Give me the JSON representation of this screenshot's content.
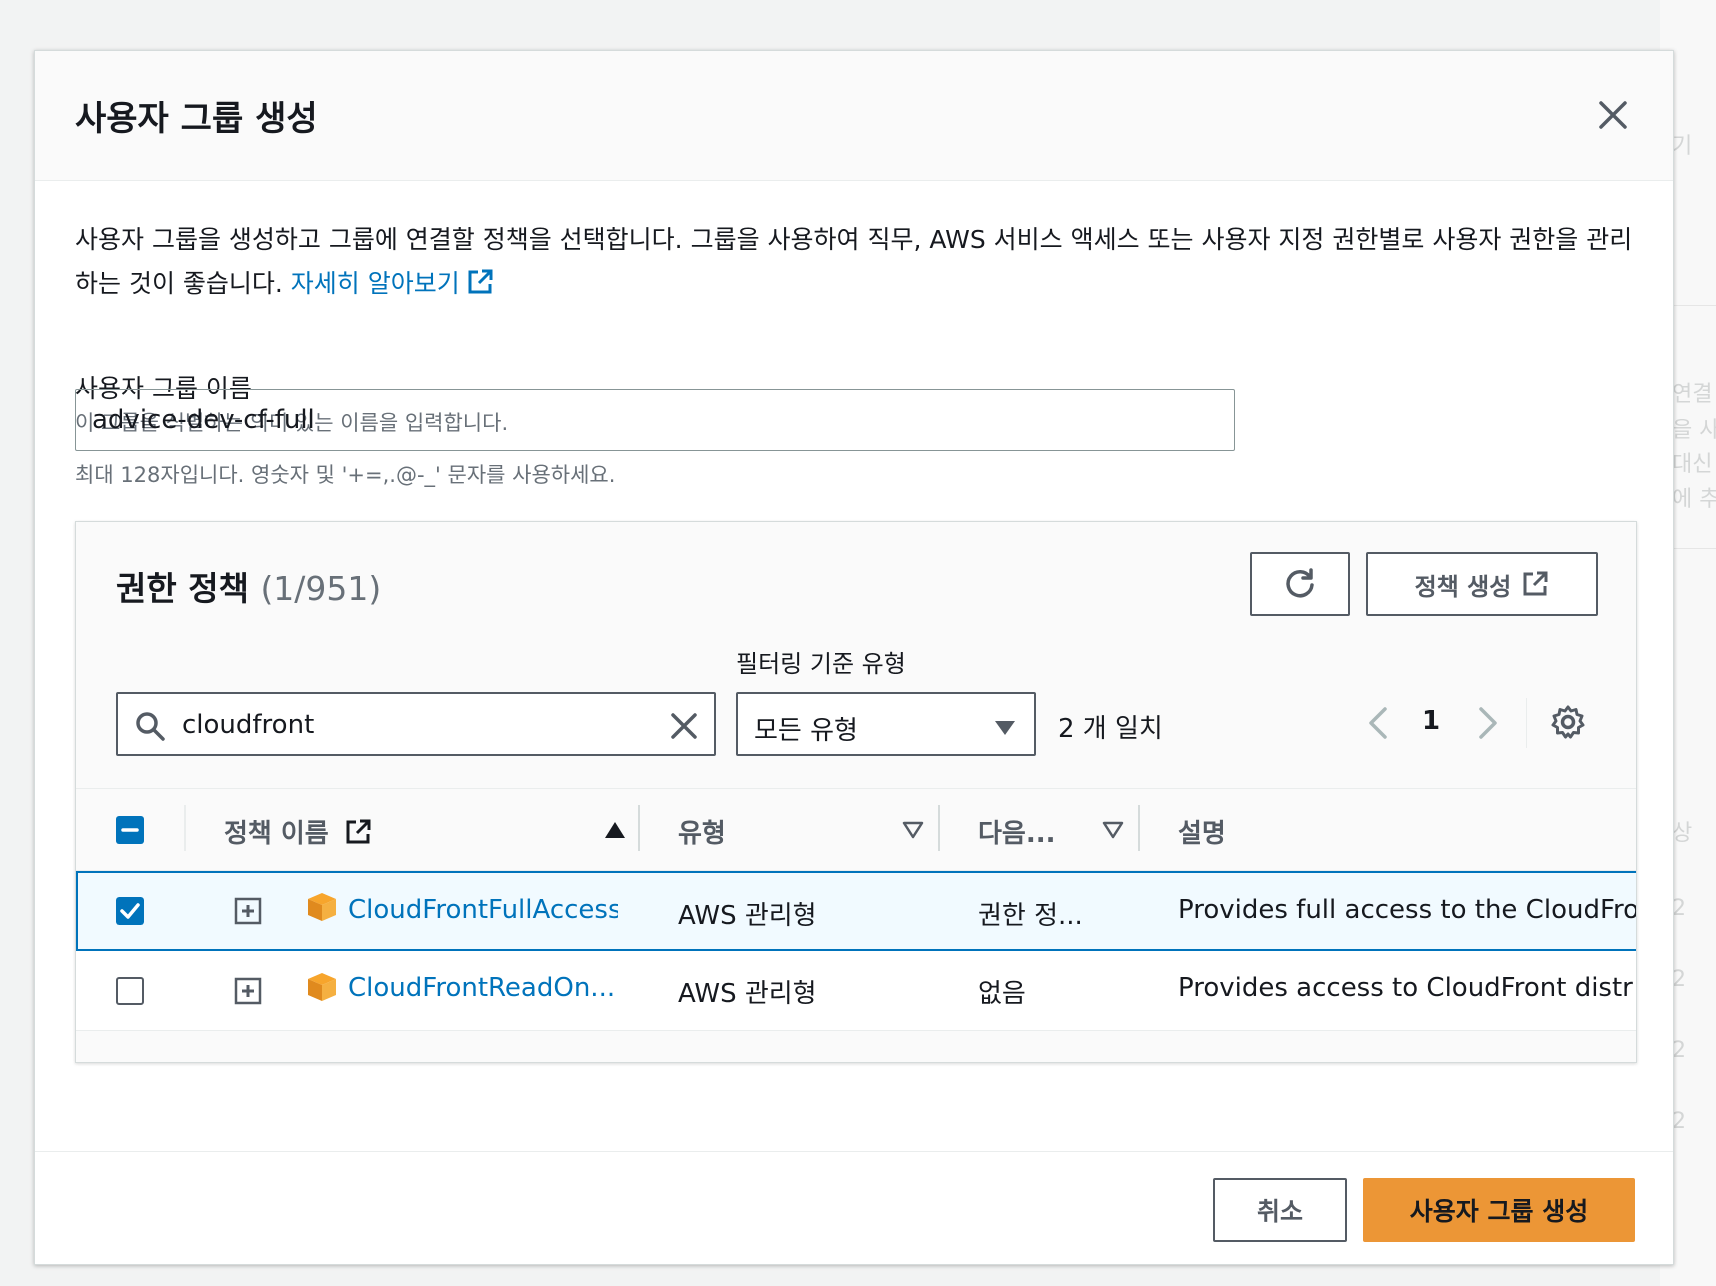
{
  "background": {
    "fragments": [
      "기",
      "연결",
      "을 사",
      "대신",
      "에 추",
      "상",
      "2",
      "2",
      "2",
      "2"
    ]
  },
  "modal": {
    "title": "사용자 그룹 생성",
    "intro_text": "사용자 그룹을 생성하고 그룹에 연결할 정책을 선택합니다. 그룹을 사용하여 직무, AWS 서비스 액세스 또는 사용자 지정 권한별로 사용자 권한을 관리하는 것이 좋습니다.",
    "learn_more": "자세히 알아보기"
  },
  "group_name": {
    "label": "사용자 그룹 이름",
    "description": "이 그룹을 식별하는 의미 있는 이름을 입력합니다.",
    "value": "advice-dev-cf-full",
    "hint": "최대 128자입니다. 영숫자 및 '+=,.@-_' 문자를 사용하세요."
  },
  "policies": {
    "title": "권한 정책",
    "count": "(1/951)",
    "create_policy": "정책 생성",
    "filter_label": "필터링 기준 유형",
    "search_value": "cloudfront",
    "type_selected": "모든 유형",
    "match_count": "2 개 일치",
    "page": "1",
    "columns": {
      "name": "정책 이름",
      "type": "유형",
      "used_as": "다음...",
      "description": "설명"
    },
    "rows": [
      {
        "name": "CloudFrontFullAccess",
        "type": "AWS 관리형",
        "used_as": "권한 정...",
        "description": "Provides full access to the CloudFro",
        "checked": true
      },
      {
        "name": "CloudFrontReadOn...",
        "type": "AWS 관리형",
        "used_as": "없음",
        "description": "Provides access to CloudFront distr",
        "checked": false
      }
    ]
  },
  "footer": {
    "cancel": "취소",
    "submit": "사용자 그룹 생성"
  },
  "colors": {
    "accent": "#0073bb",
    "primary_button": "#ec9636",
    "aws_icon": "#f7a52c"
  }
}
